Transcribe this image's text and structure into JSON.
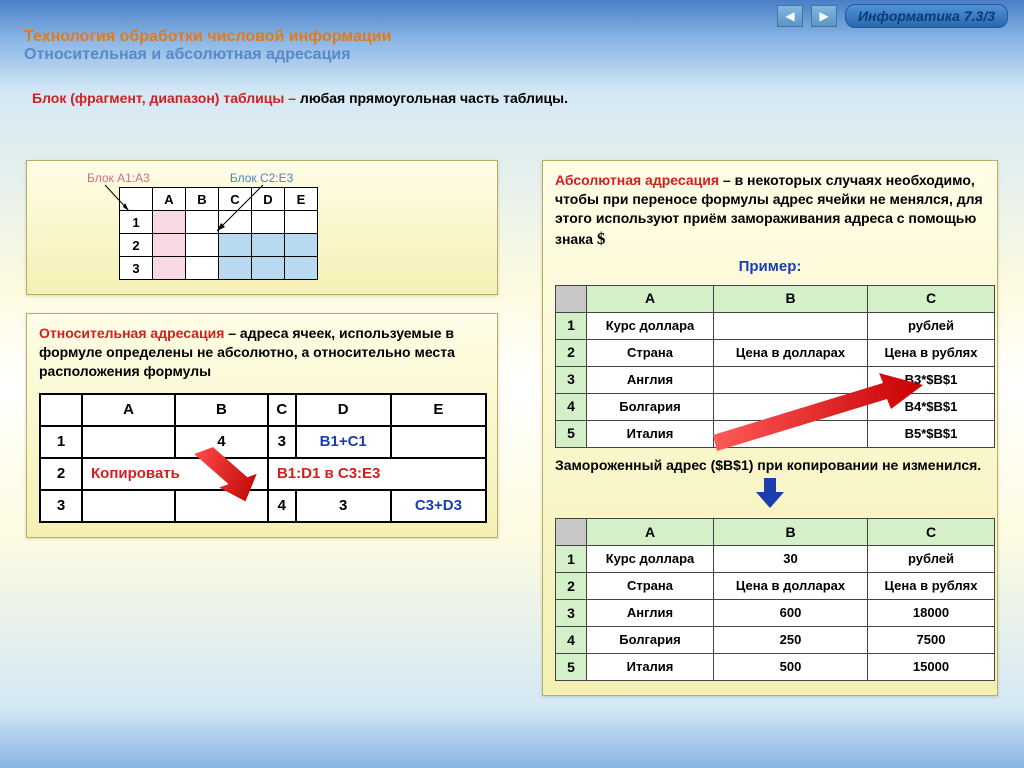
{
  "header": {
    "badge": "Информатика 7.3/3",
    "title1": "Технология обработки числовой информации",
    "title2": "Относительная и абсолютная адресация",
    "def_term": "Блок (фрагмент, диапазон) таблицы – ",
    "def_body": "любая прямоугольная часть таблицы."
  },
  "left": {
    "block_a": "Блок А1:А3",
    "block_c": "Блок С2:Е3",
    "mini_cols": [
      "A",
      "B",
      "C",
      "D",
      "E"
    ],
    "mini_rows": [
      "1",
      "2",
      "3"
    ],
    "rel_term": "Относительная адресация",
    "rel_body": " – адреса ячеек, используемые в формуле определены не абсолютно, а относительно места расположения формулы",
    "wide_cols": [
      "A",
      "B",
      "C",
      "D",
      "E"
    ],
    "wide_rows": [
      "1",
      "2",
      "3"
    ],
    "r1": {
      "b": "4",
      "c": "3",
      "d": "B1+C1"
    },
    "r2": {
      "copy": "Копировать",
      "dest": "В1:D1 в С3:Е3"
    },
    "r3": {
      "c": "4",
      "d": "3",
      "e": "C3+D3"
    }
  },
  "right": {
    "abs_term": "Абсолютная адресация",
    "abs_body": " – в некоторых случаях необходимо, чтобы при переносе формулы адрес ячейки не менялся, для этого используют приём замораживания адреса с помощью знака ",
    "dollar": "$",
    "example": "Пример:",
    "sheet_cols": [
      "А",
      "В",
      "С"
    ],
    "sheet_rows": [
      "1",
      "2",
      "3",
      "4",
      "5"
    ],
    "s1": [
      [
        "Курс доллара",
        "",
        "рублей"
      ],
      [
        "Страна",
        "Цена в долларах",
        "Цена в рублях"
      ],
      [
        "Англия",
        "",
        "B3*$B$1"
      ],
      [
        "Болгария",
        "",
        "B4*$B$1"
      ],
      [
        "Италия",
        "",
        "B5*$B$1"
      ]
    ],
    "frozen": "Замороженный адрес ($B$1) при копировании не изменился.",
    "s2": [
      [
        "Курс доллара",
        "30",
        "рублей"
      ],
      [
        "Страна",
        "Цена в долларах",
        "Цена в рублях"
      ],
      [
        "Англия",
        "600",
        "18000"
      ],
      [
        "Болгария",
        "250",
        "7500"
      ],
      [
        "Италия",
        "500",
        "15000"
      ]
    ]
  }
}
